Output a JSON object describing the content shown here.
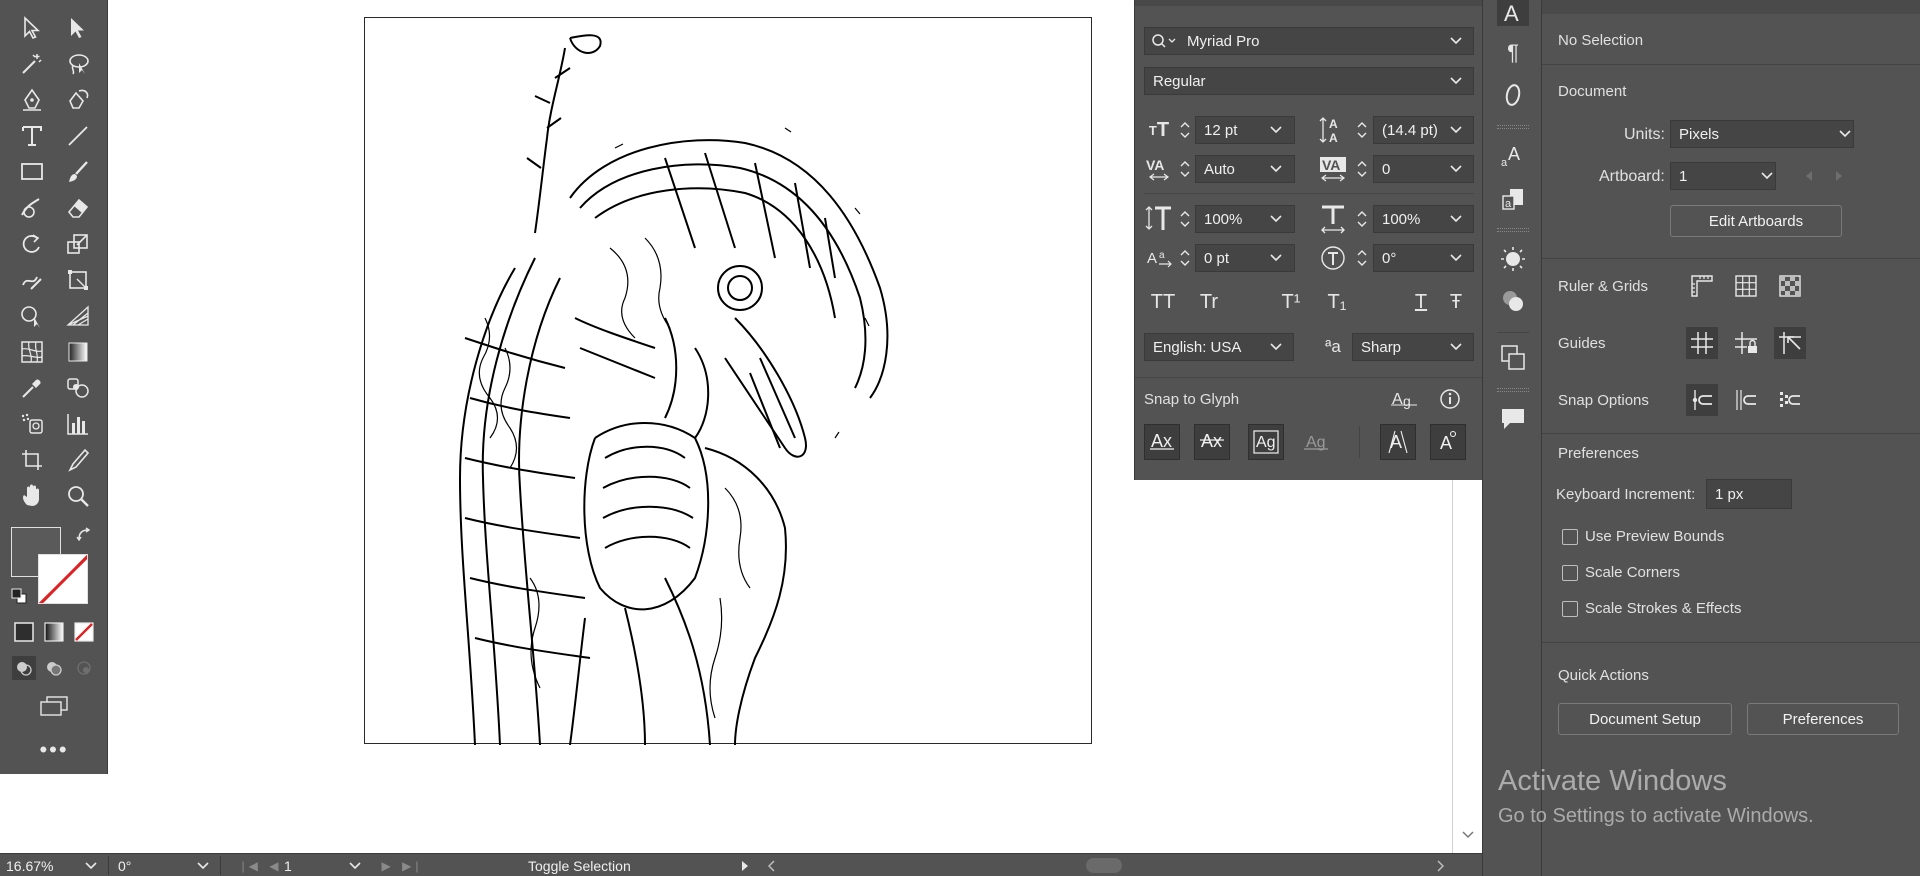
{
  "character": {
    "font_family": "Myriad Pro",
    "font_style": "Regular",
    "font_size": "12 pt",
    "leading": "(14.4 pt)",
    "kerning": "Auto",
    "tracking": "0",
    "vertical_scale": "100%",
    "horizontal_scale": "100%",
    "baseline_shift": "0 pt",
    "rotation": "0°",
    "language": "English: USA",
    "anti_alias": "Sharp",
    "snap_to_glyph_label": "Snap to Glyph",
    "caps_labels": [
      "TT",
      "Tr",
      "T¹",
      "T₁",
      "T",
      "Ŧ"
    ],
    "aa_label": "ªa"
  },
  "properties": {
    "selection": "No Selection",
    "document_heading": "Document",
    "units_label": "Units:",
    "units_value": "Pixels",
    "artboard_label": "Artboard:",
    "artboard_value": "1",
    "edit_artboards": "Edit Artboards",
    "ruler_grids": "Ruler & Grids",
    "guides": "Guides",
    "snap_options": "Snap Options",
    "preferences_heading": "Preferences",
    "keyboard_increment_label": "Keyboard Increment:",
    "keyboard_increment_value": "1 px",
    "use_preview_bounds": "Use Preview Bounds",
    "scale_corners": "Scale Corners",
    "scale_strokes": "Scale Strokes & Effects",
    "quick_actions": "Quick Actions",
    "document_setup": "Document Setup",
    "preferences_btn": "Preferences"
  },
  "status": {
    "zoom": "16.67%",
    "rotate": "0°",
    "artboard": "1",
    "toggle": "Toggle Selection"
  },
  "watermark": {
    "line1": "Activate Windows",
    "line2": "Go to Settings to activate Windows."
  },
  "colors": {
    "panel": "#535353",
    "field": "#454545",
    "fill_swatch": "#5a5a5a",
    "none_red": "#e02020"
  }
}
